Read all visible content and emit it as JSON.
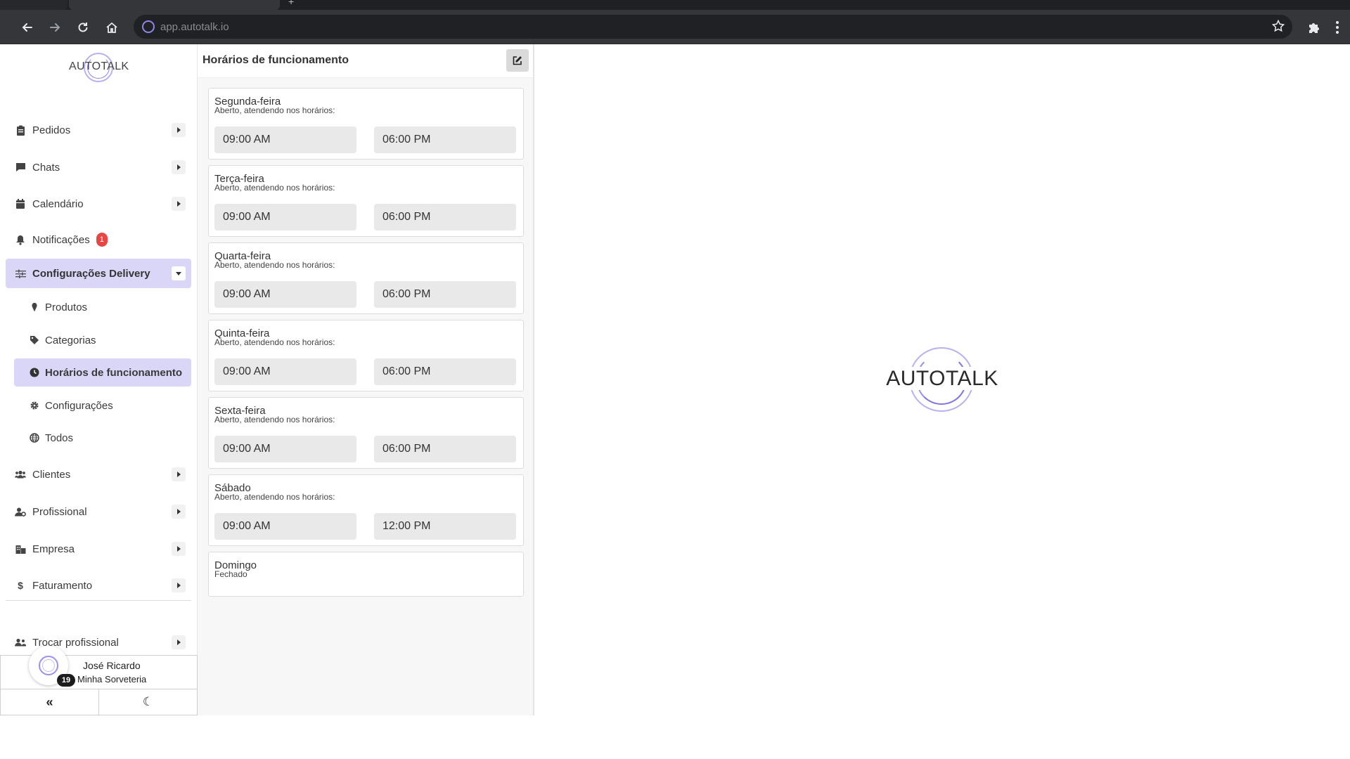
{
  "browser": {
    "url": "app.autotalk.io"
  },
  "brand": {
    "logo_text": "AUTOTALK",
    "accent": "#8f86e8",
    "active_bg": "#d9d6f7"
  },
  "sidebar": {
    "items": [
      {
        "label": "Pedidos",
        "icon": "clipboard-icon"
      },
      {
        "label": "Chats",
        "icon": "chat-icon"
      },
      {
        "label": "Calendário",
        "icon": "calendar-icon"
      },
      {
        "label": "Notificações",
        "icon": "bell-icon",
        "badge": "1"
      },
      {
        "label": "Configurações Delivery",
        "icon": "sliders-icon"
      }
    ],
    "sub_items": [
      {
        "label": "Produtos",
        "icon": "ice-cream-icon"
      },
      {
        "label": "Categorias",
        "icon": "tag-icon"
      },
      {
        "label": "Horários de funcionamento",
        "icon": "clock-icon"
      },
      {
        "label": "Configurações",
        "icon": "gear-icon"
      },
      {
        "label": "Todos",
        "icon": "globe-icon"
      }
    ],
    "items_bottom": [
      {
        "label": "Clientes",
        "icon": "users-icon"
      },
      {
        "label": "Profissional",
        "icon": "user-gear-icon"
      },
      {
        "label": "Empresa",
        "icon": "building-icon"
      },
      {
        "label": "Faturamento",
        "icon": "dollar-icon"
      }
    ],
    "switch_label": "Trocar profissional",
    "user": {
      "name": "José Ricardo",
      "company": "Minha Sorveteria",
      "count": "19"
    },
    "footer": {
      "collapse": "«",
      "theme": "☾"
    }
  },
  "schedule": {
    "title": "Horários de funcionamento",
    "days": [
      {
        "name": "Segunda-feira",
        "status": "Aberto, atendendo nos horários:",
        "open": "09:00 AM",
        "close": "06:00 PM"
      },
      {
        "name": "Terça-feira",
        "status": "Aberto, atendendo nos horários:",
        "open": "09:00 AM",
        "close": "06:00 PM"
      },
      {
        "name": "Quarta-feira",
        "status": "Aberto, atendendo nos horários:",
        "open": "09:00 AM",
        "close": "06:00 PM"
      },
      {
        "name": "Quinta-feira",
        "status": "Aberto, atendendo nos horários:",
        "open": "09:00 AM",
        "close": "06:00 PM"
      },
      {
        "name": "Sexta-feira",
        "status": "Aberto, atendendo nos horários:",
        "open": "09:00 AM",
        "close": "06:00 PM"
      },
      {
        "name": "Sábado",
        "status": "Aberto, atendendo nos horários:",
        "open": "09:00 AM",
        "close": "12:00 PM"
      },
      {
        "name": "Domingo",
        "status": "Fechado"
      }
    ]
  }
}
